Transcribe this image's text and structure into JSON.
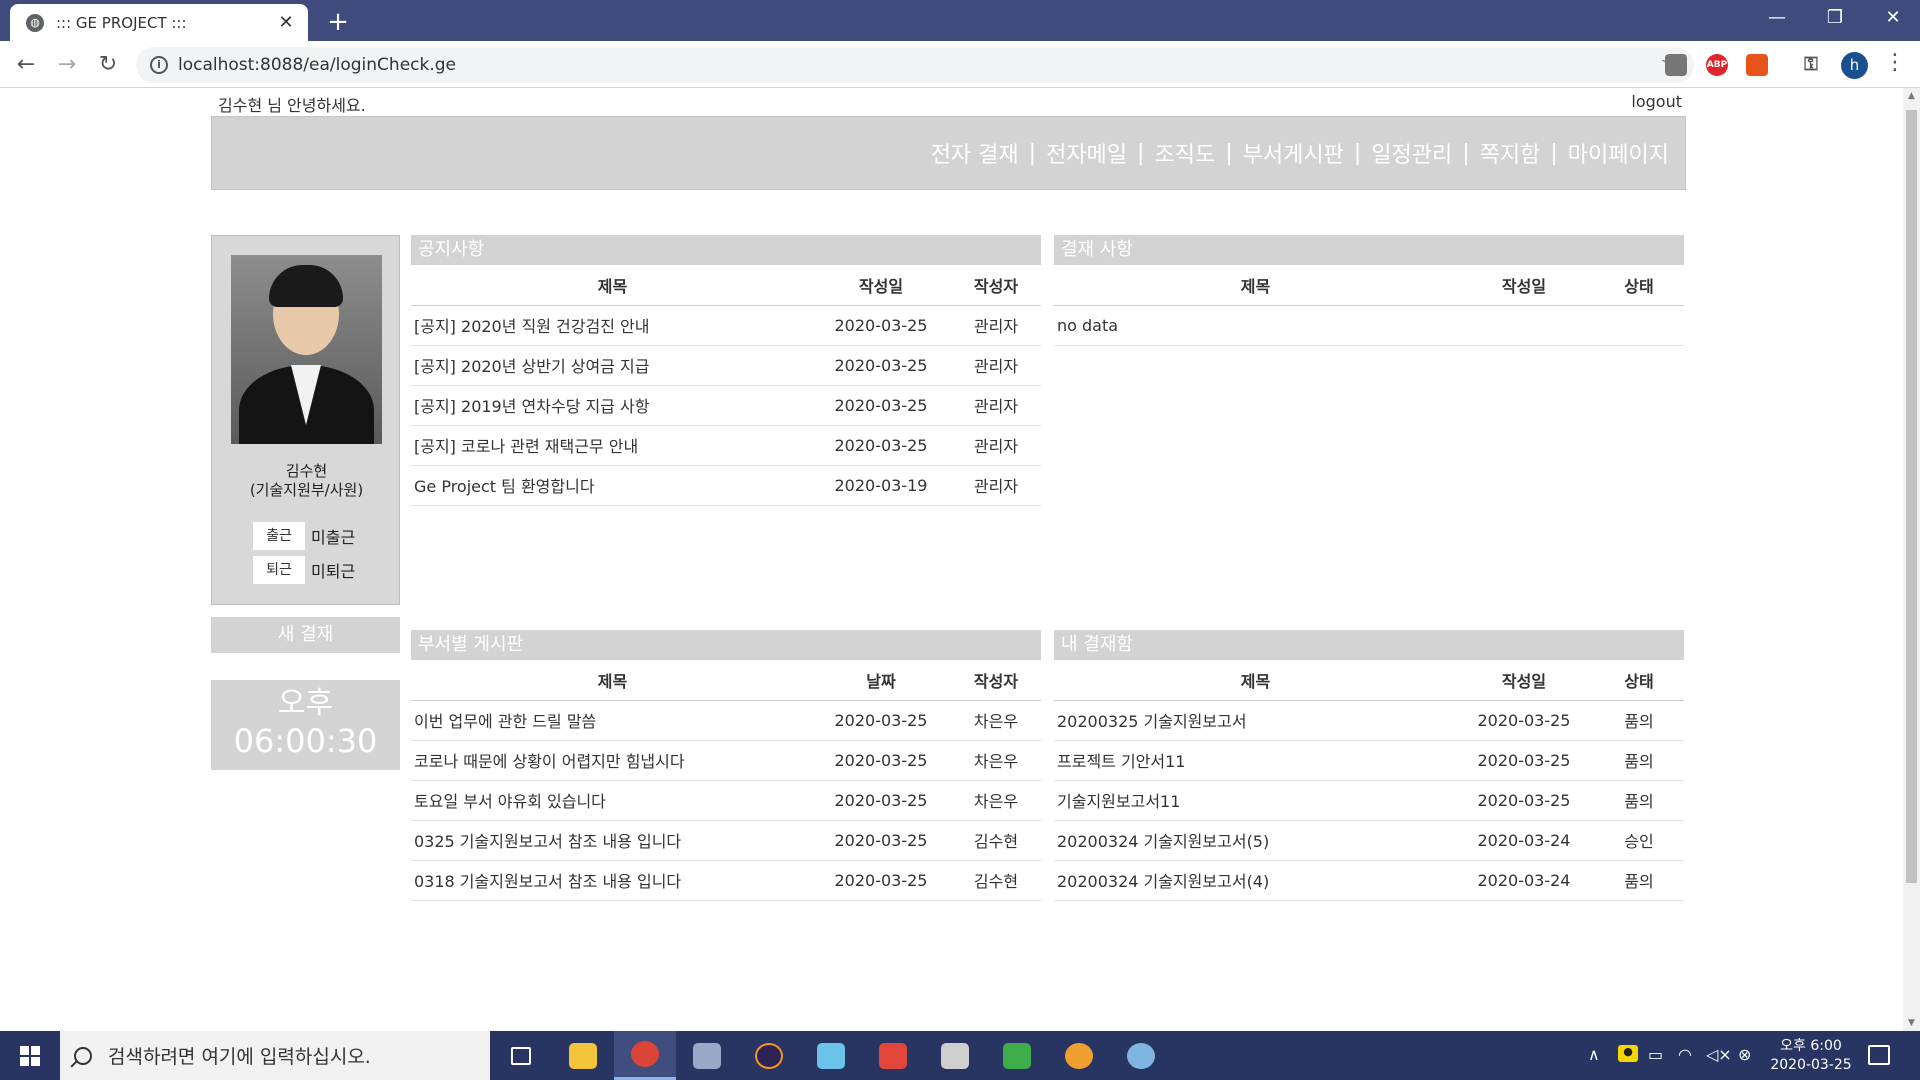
{
  "browser": {
    "tab_title": "::: GE PROJECT :::",
    "url": "localhost:8088/ea/loginCheck.ge"
  },
  "header": {
    "greeting": "김수현 님 안녕하세요.",
    "logout": "logout",
    "menu": [
      "전자 결재",
      "전자메일",
      "조직도",
      "부서게시판",
      "일정관리",
      "쪽지함",
      "마이페이지"
    ],
    "separator": "|"
  },
  "profile": {
    "name": "김수현",
    "dept": "(기술지원부/사원)",
    "checkin_label": "출근",
    "checkin_status": "미출근",
    "checkout_label": "퇴근",
    "checkout_status": "미퇴근",
    "new_approval": "새 결재",
    "clock_ampm": "오후",
    "clock_time": "06:00:30"
  },
  "notices": {
    "title": "공지사항",
    "headers": [
      "제목",
      "작성일",
      "작성자"
    ],
    "rows": [
      [
        "[공지] 2020년 직원 건강검진 안내",
        "2020-03-25",
        "관리자"
      ],
      [
        "[공지] 2020년 상반기 상여금 지급",
        "2020-03-25",
        "관리자"
      ],
      [
        "[공지] 2019년 연차수당 지급 사항",
        "2020-03-25",
        "관리자"
      ],
      [
        "[공지] 코로나 관련 재택근무 안내",
        "2020-03-25",
        "관리자"
      ],
      [
        "Ge Project 팀 환영합니다",
        "2020-03-19",
        "관리자"
      ]
    ]
  },
  "approvals": {
    "title": "결재 사항",
    "headers": [
      "제목",
      "작성일",
      "상태"
    ],
    "empty": "no data"
  },
  "dept_board": {
    "title": "부서별 게시판",
    "headers": [
      "제목",
      "날짜",
      "작성자"
    ],
    "rows": [
      [
        "이번 업무에 관한 드릴 말씀",
        "2020-03-25",
        "차은우"
      ],
      [
        "코로나 때문에 상황이 어렵지만 힘냅시다",
        "2020-03-25",
        "차은우"
      ],
      [
        "토요일 부서 야유회 있습니다",
        "2020-03-25",
        "차은우"
      ],
      [
        "0325 기술지원보고서 참조 내용 입니다",
        "2020-03-25",
        "김수현"
      ],
      [
        "0318 기술지원보고서 참조 내용 입니다",
        "2020-03-25",
        "김수현"
      ]
    ]
  },
  "my_approvals": {
    "title": "내 결재함",
    "headers": [
      "제목",
      "작성일",
      "상태"
    ],
    "rows": [
      [
        "20200325 기술지원보고서",
        "2020-03-25",
        "품의"
      ],
      [
        "프로젝트 기안서11",
        "2020-03-25",
        "품의"
      ],
      [
        "기술지원보고서11",
        "2020-03-25",
        "품의"
      ],
      [
        "20200324 기술지원보고서(5)",
        "2020-03-24",
        "승인"
      ],
      [
        "20200324 기술지원보고서(4)",
        "2020-03-24",
        "품의"
      ]
    ]
  },
  "taskbar": {
    "search_placeholder": "검색하려면 여기에 입력하십시오.",
    "clock_time": "오후 6:00",
    "clock_date": "2020-03-25"
  },
  "colors": {
    "titlebar": "#3f4a7d",
    "panel_header": "#d3d3d3",
    "taskbar": "#283562"
  }
}
